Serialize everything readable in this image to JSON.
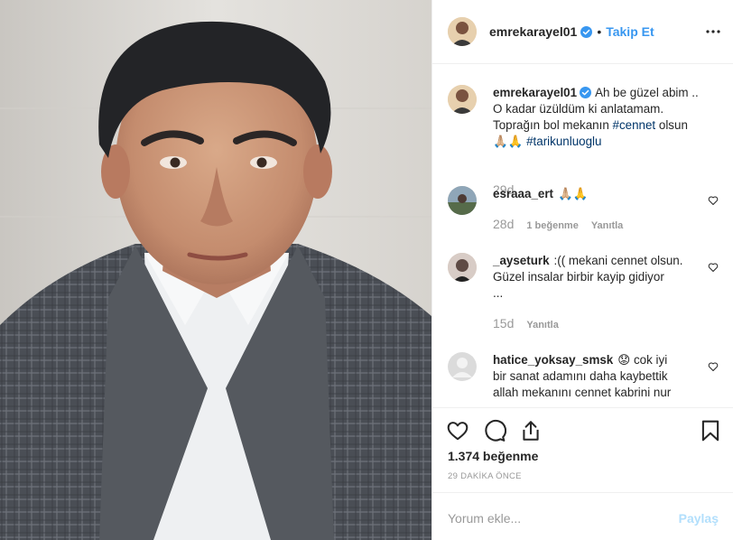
{
  "post": {
    "username": "emrekarayel01",
    "follow_label": "Takip Et",
    "dot": "•"
  },
  "caption": {
    "username": "emrekarayel01",
    "line1": "Ah be güzel abim ..",
    "line2": "O kadar üzüldüm ki anlatamam.",
    "line3_pre": "Toprağın bol mekanın ",
    "line3_tag": "#cennet",
    "line3_post": " olsun",
    "line4_emoji": "🙏🏼🙏",
    "line4_tag": "#tarikunluoglu",
    "time": "29d"
  },
  "comments": [
    {
      "username": "esraaa_ert",
      "text": "🙏🏼🙏",
      "time": "28d",
      "likes": "1 beğenme",
      "reply": "Yanıtla"
    },
    {
      "username": "_ayseturk",
      "text_line1": ":(( mekani cennet olsun.",
      "text_line2": "Güzel insalar birbir kayip gidiyor",
      "text_line3": "...",
      "time": "15d",
      "reply": "Yanıtla"
    },
    {
      "username": "hatice_yoksay_smsk",
      "emoji": "😟",
      "text_line1": "cok iyi",
      "text_line2": "bir sanat adamını daha kaybettik",
      "text_line3": "allah mekanını cennet kabrini nur"
    }
  ],
  "stats": {
    "likes": "1.374 beğenme",
    "ago": "29 DAKİKA ÖNCE"
  },
  "add_comment": {
    "placeholder": "Yorum ekle...",
    "share": "Paylaş"
  },
  "colors": {
    "accent": "#3897f0",
    "hashtag": "#003569",
    "muted": "#999999"
  }
}
